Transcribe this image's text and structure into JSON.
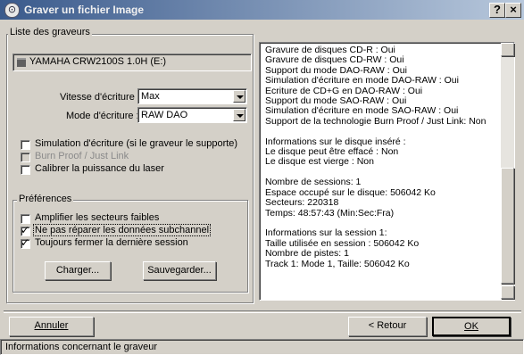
{
  "window": {
    "title": "Graver un fichier Image",
    "icon": "disc-icon",
    "help_button": "?",
    "close_button": "×"
  },
  "writers": {
    "group_label": "Liste des graveurs",
    "selected_writer": "YAMAHA CRW2100S 1.0H (E:)",
    "speed_label": "Vitesse d'écriture :",
    "speed_value": "Max",
    "mode_label": "Mode d'écriture :",
    "mode_value": "RAW DAO"
  },
  "options": [
    {
      "label": "Simulation d'écriture (si le graveur le supporte)",
      "checked": false,
      "enabled": true
    },
    {
      "label": "Burn Proof / Just Link",
      "checked": false,
      "enabled": false
    },
    {
      "label": "Calibrer la puissance du laser",
      "checked": false,
      "enabled": true
    }
  ],
  "preferences": {
    "group_label": "Préférences",
    "items": [
      {
        "label": "Amplifier les secteurs faibles",
        "checked": false
      },
      {
        "label": "Ne pas réparer les données subchannel",
        "checked": true
      },
      {
        "label": "Toujours fermer la dernière session",
        "checked": true
      }
    ],
    "load_button": "Charger...",
    "save_button": "Sauvegarder..."
  },
  "info": {
    "lines": [
      "Gravure de disques CD-R : Oui",
      "Gravure de disques CD-RW : Oui",
      "Support du mode DAO-RAW : Oui",
      "Simulation d'écriture en mode DAO-RAW : Oui",
      "Ecriture de CD+G en DAO-RAW : Oui",
      "Support du mode SAO-RAW : Oui",
      "Simulation d'écriture en mode SAO-RAW : Oui",
      "Support de la technologie Burn Proof / Just Link: Non",
      "",
      "Informations sur le disque inséré :",
      "Le disque peut être effacé : Non",
      "Le disque est vierge : Non",
      "",
      "Nombre de sessions: 1",
      "Espace occupé sur le disque: 506042 Ko",
      "Secteurs: 220318",
      "Temps: 48:57:43 (Min:Sec:Fra)",
      "",
      "Informations sur la session 1:",
      "Taille utilisée en session : 506042 Ko",
      "Nombre de pistes: 1",
      "Track 1: Mode 1, Taille: 506042 Ko"
    ]
  },
  "footer": {
    "cancel_button": "Annuler",
    "back_button": "< Retour",
    "ok_button": "OK",
    "status_text": "Informations concernant le graveur"
  }
}
